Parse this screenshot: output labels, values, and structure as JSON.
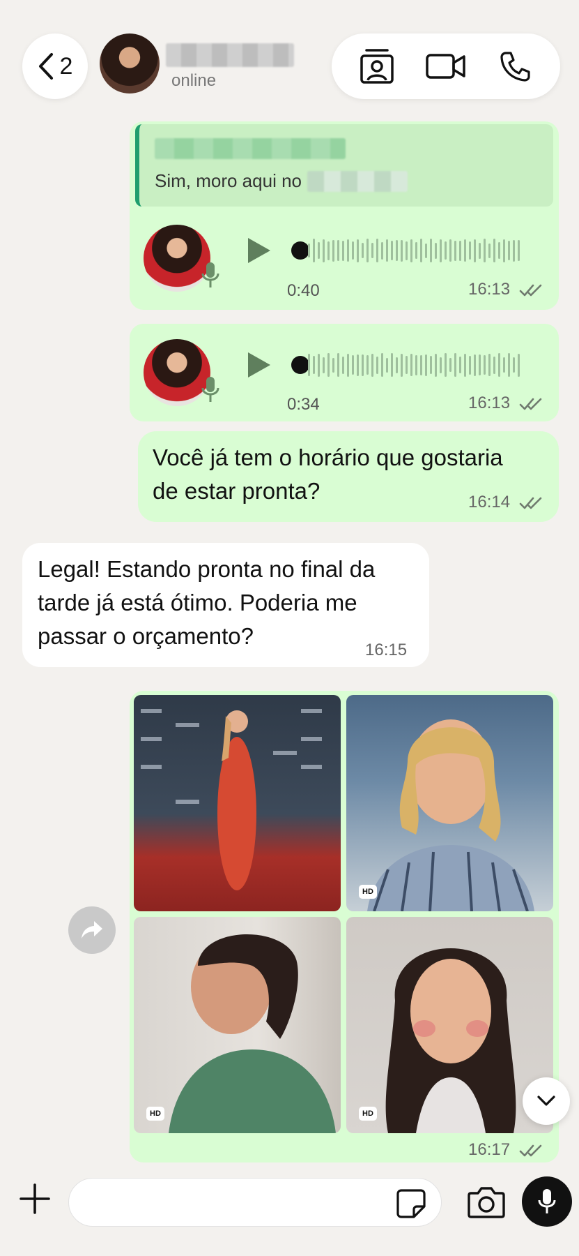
{
  "header": {
    "back_count": "2",
    "contact_status": "online",
    "icons": [
      "chevron-left-icon",
      "contact-card-icon",
      "video-call-icon",
      "phone-call-icon"
    ]
  },
  "messages": {
    "quote_text": "Sim, moro aqui no",
    "voice1": {
      "duration": "0:40",
      "time": "16:13"
    },
    "voice2": {
      "duration": "0:34",
      "time": "16:13"
    },
    "out_text": {
      "lines": [
        "Você já tem o horário que gostaria",
        "de estar pronta?"
      ],
      "time": "16:14"
    },
    "in_text": {
      "lines": [
        "Legal! Estando pronta no final da",
        "tarde já está ótimo. Poderia me",
        "passar o orçamento?"
      ],
      "time": "16:15"
    },
    "album": {
      "hd_label": "HD",
      "time": "16:17"
    }
  },
  "composer": {
    "placeholder": "",
    "icons": [
      "plus-icon",
      "sticker-icon",
      "camera-icon",
      "mic-icon"
    ]
  },
  "colors": {
    "outgoing_bubble": "#d9fdd3",
    "incoming_bubble": "#ffffff",
    "background": "#f3f1ee",
    "quote_bar": "#1f9e6e"
  }
}
